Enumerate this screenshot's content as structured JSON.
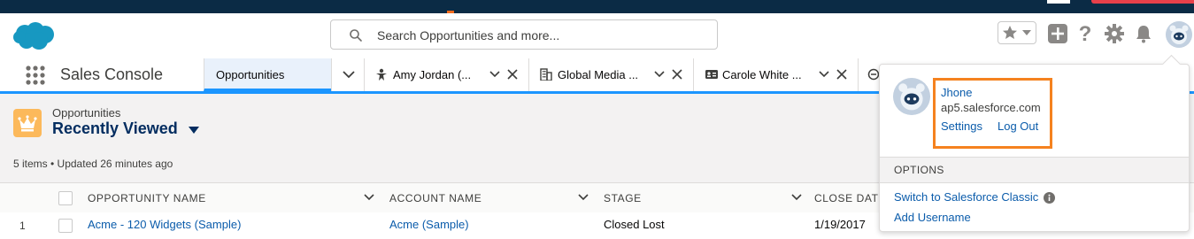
{
  "colors": {
    "brand_blue": "#1b96ff",
    "link_blue": "#0b5cab",
    "highlight_orange": "#f5821f",
    "crown_yellow": "#fcb95b",
    "top_strip": "#0b2b45"
  },
  "search": {
    "placeholder": "Search Opportunities and more..."
  },
  "nav": {
    "app_name": "Sales Console",
    "tabs": [
      {
        "label": "Opportunities",
        "icon": "none",
        "active": true
      },
      {
        "label": "Amy Jordan (...",
        "icon": "person-icon",
        "active": false
      },
      {
        "label": "Global Media ...",
        "icon": "building-icon",
        "active": false
      },
      {
        "label": "Carole White ...",
        "icon": "contact-card-icon",
        "active": false
      }
    ]
  },
  "list": {
    "object_label": "Opportunities",
    "view_name": "Recently Viewed",
    "meta": "5 items • Updated 26 minutes ago",
    "columns": [
      "OPPORTUNITY NAME",
      "ACCOUNT NAME",
      "STAGE",
      "CLOSE DAT"
    ],
    "first_row": {
      "num": "1",
      "name": "Acme - 120 Widgets (Sample)",
      "account": "Acme (Sample)",
      "stage": "Closed Lost",
      "close": "1/19/2017"
    }
  },
  "user_menu": {
    "name": "Jhone",
    "domain": "ap5.salesforce.com",
    "settings_label": "Settings",
    "logout_label": "Log Out",
    "options_header": "OPTIONS",
    "options": [
      "Switch to Salesforce Classic",
      "Add Username"
    ]
  }
}
